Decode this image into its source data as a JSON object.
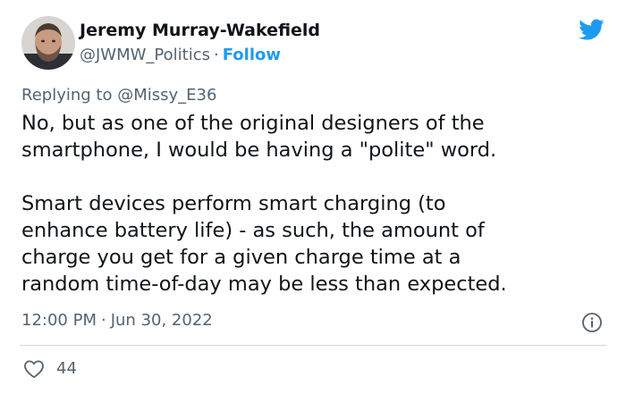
{
  "author": {
    "name": "Jeremy Murray-Wakefield",
    "handle": "@JWMW_Politics",
    "separator": "·",
    "follow_label": "Follow"
  },
  "reply": {
    "prefix": "Replying to ",
    "mention": "@Missy_E36"
  },
  "tweet": {
    "paragraph1_lines": [
      "No, but as one of the original designers of the",
      "smartphone, I would be having a \"polite\" word."
    ],
    "paragraph2_lines": [
      "Smart devices perform smart charging (to",
      "enhance battery life) - as such, the amount of",
      "charge you get for a given charge time at a",
      "random time-of-day may be less than expected."
    ]
  },
  "meta": {
    "time": "12:00 PM",
    "separator": "·",
    "date": "Jun 30, 2022"
  },
  "engagement": {
    "likes": "44"
  },
  "icons": {
    "brand": "twitter-bird-icon",
    "info": "info-icon",
    "like": "heart-icon"
  },
  "colors": {
    "brand": "#1d9bf0",
    "text": "#0f1419",
    "secondary": "#536471",
    "divider": "#cfd9de"
  }
}
